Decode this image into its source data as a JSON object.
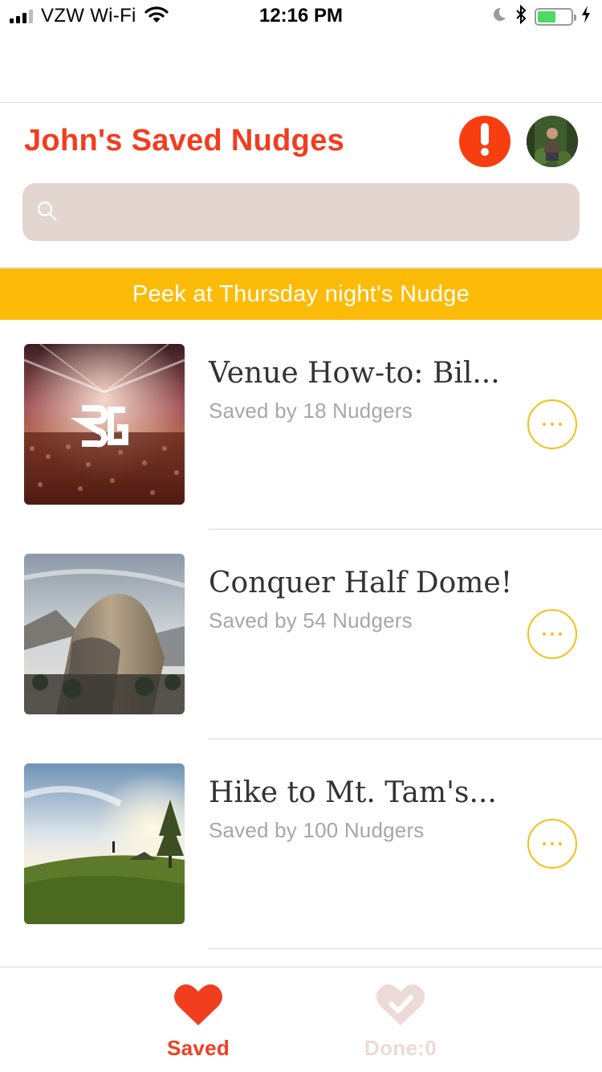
{
  "status_bar": {
    "carrier": "VZW Wi-Fi",
    "time": "12:16 PM",
    "battery_level": 0.55
  },
  "header": {
    "title": "John's Saved Nudges",
    "alert_icon": "exclamation-icon",
    "search": {
      "placeholder": "",
      "value": ""
    }
  },
  "banner": {
    "text": "Peek at Thursday night's Nudge"
  },
  "nudges": [
    {
      "title": "Venue How-to: Bil...",
      "subtitle": "Saved by 18 Nudgers",
      "image": "concert-crowd-photo"
    },
    {
      "title": "Conquer Half Dome!",
      "subtitle": "Saved by 54 Nudgers",
      "image": "half-dome-photo"
    },
    {
      "title": "Hike to Mt. Tam's...",
      "subtitle": "Saved by 100 Nudgers",
      "image": "mountain-sunset-photo"
    }
  ],
  "tabs": [
    {
      "label": "Saved",
      "icon": "heart-icon",
      "active": true
    },
    {
      "label": "Done:0",
      "icon": "heart-check-icon",
      "active": false
    }
  ],
  "colors": {
    "brand_red": "#f23d1e",
    "banner_yellow": "#fdbb09",
    "search_bg": "#e3d5d0",
    "inactive_tab": "#ecdad6"
  }
}
